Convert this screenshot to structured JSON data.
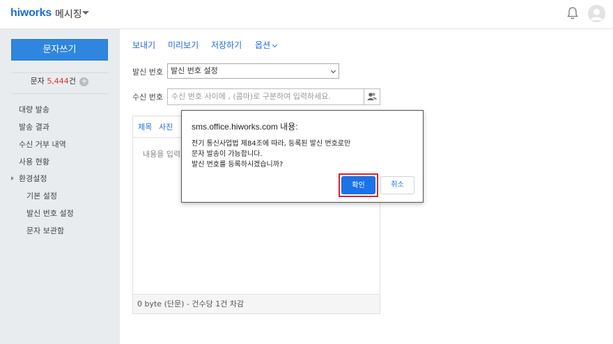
{
  "header": {
    "logo": "hiworks",
    "app_title": "메시징"
  },
  "sidebar": {
    "compose_label": "문자쓰기",
    "count_prefix": "문자 ",
    "count_value": "5,444",
    "count_suffix": "건",
    "plus_symbol": "+",
    "items": [
      {
        "label": "대량 발송"
      },
      {
        "label": "발송 결과"
      },
      {
        "label": "수신 거부 내역"
      },
      {
        "label": "사용 현황"
      },
      {
        "label": "환경설정"
      }
    ],
    "sub_items": [
      {
        "label": "기본 설정"
      },
      {
        "label": "발신 번호 설정"
      },
      {
        "label": "문자 보관함"
      }
    ]
  },
  "toolbar": {
    "send": "보내기",
    "preview": "미리보기",
    "save": "저장하기",
    "options": "옵션"
  },
  "form": {
    "sender_label": "발신 번호",
    "sender_selected": "발신 번호 설정",
    "recipient_label": "수신 번호",
    "recipient_placeholder": "수신 번호 사이에 , (콤마)로 구분하여 입력하세요."
  },
  "editor": {
    "tab_subject": "제목",
    "tab_photo": "사진",
    "placeholder": "내용을 입력",
    "footer": "0 byte (단문) - 건수당 1건 차감"
  },
  "dialog": {
    "title": "sms.office.hiworks.com 내용:",
    "message_lines": [
      "전기 통신사업법 제84조에 따라, 등록된 발신 번호로만",
      "문자 발송이 가능합니다.",
      "발신 번호를 등록하시겠습니까?"
    ],
    "ok_label": "확인",
    "cancel_label": "취소"
  },
  "colors": {
    "brand_blue": "#1d6bd8",
    "compose_blue": "#2e86de",
    "highlight_red": "#d9232b",
    "count_red": "#d9342b"
  }
}
